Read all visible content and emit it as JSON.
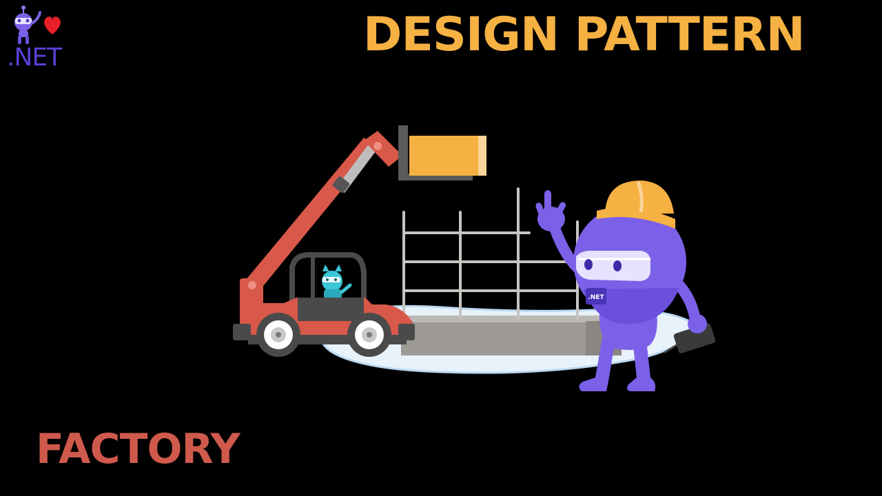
{
  "header": {
    "title": "DESIGN PATTERN"
  },
  "logo": {
    "text": ".NET"
  },
  "footer": {
    "subtitle": "FACTORY"
  },
  "illustration": {
    "mascot_badge": ".NET"
  },
  "colors": {
    "background": "#000000",
    "title": "#f6b143",
    "subtitle": "#cf5a4c",
    "brand_purple": "#5b3fd6",
    "mascot_purple": "#7b61e8",
    "hardhat": "#f6b143",
    "telehandler": "#d8584a",
    "cargo": "#f6b143"
  }
}
